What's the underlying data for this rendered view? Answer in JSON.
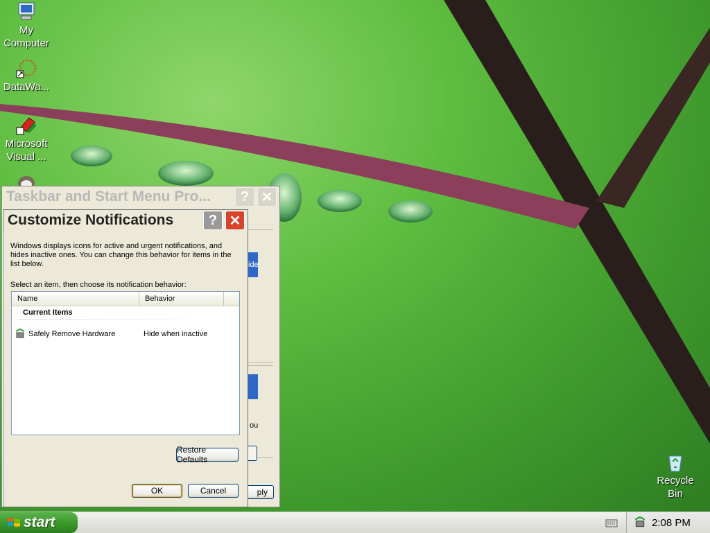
{
  "desktop": {
    "icons": [
      {
        "label": "My Computer",
        "icon": "my-computer-icon"
      },
      {
        "label": "DataWa...",
        "icon": "datawa-shortcut-icon"
      },
      {
        "label": "Microsoft Visual ...",
        "icon": "microsoft-visual-shortcut-icon"
      },
      {
        "label": "Recycle Bin",
        "icon": "recycle-bin-icon"
      }
    ]
  },
  "taskbar_props_window": {
    "title": "Taskbar and Start Menu Pro...",
    "help_glyph": "?",
    "close_glyph": "✕",
    "partial_texts": {
      "hide_fragment": "ide",
      "you_fragment": "ou"
    },
    "apply_label_fragment": "ply"
  },
  "customize_dialog": {
    "title": "Customize Notifications",
    "help_glyph": "?",
    "close_glyph": "✕",
    "description": "Windows displays icons for active and urgent notifications, and hides inactive ones. You can change this behavior for items in the list below.",
    "instruction": "Select an item, then choose its notification behavior:",
    "list": {
      "columns": [
        "Name",
        "Behavior"
      ],
      "group_label": "Current Items",
      "rows": [
        {
          "name": "Safely Remove Hardware",
          "behavior": "Hide when inactive",
          "icon": "safely-remove-hardware-icon"
        }
      ]
    },
    "restore_defaults_label": "Restore Defaults",
    "ok_label": "OK",
    "cancel_label": "Cancel"
  },
  "taskbar": {
    "start_label": "start",
    "clock": "2:08 PM"
  },
  "colors": {
    "accent_close": "#d8432a",
    "start_green": "#3c9a2c"
  }
}
